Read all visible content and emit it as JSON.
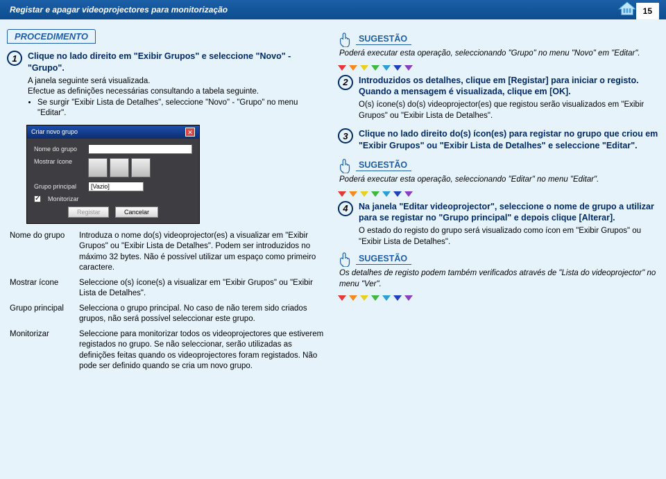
{
  "header": {
    "title": "Registar e apagar videoprojectores para monitorização",
    "page_number": "15",
    "top_icon_label": "TOP"
  },
  "procedimento_label": "PROCEDIMENTO",
  "sugestao_label": "SUGESTÃO",
  "left": {
    "step1": {
      "num": "1",
      "title": "Clique no lado direito em \"Exibir Grupos\" e seleccione \"Novo\" - \"Grupo\".",
      "line1": "A janela seguinte será visualizada.",
      "line2": "Efectue as definições necessárias consultando a tabela seguinte.",
      "bullet": "Se surgir \"Exibir Lista de Detalhes\", seleccione \"Novo\" - \"Grupo\" no menu \"Editar\"."
    },
    "dialog": {
      "title": "Criar novo grupo",
      "label_nome": "Nome do grupo",
      "label_mostrar": "Mostrar ícone",
      "label_grupo": "Grupo principal",
      "value_grupo": "[Vazio]",
      "label_monitorizar": "Monitorizar",
      "btn_registar": "Registar",
      "btn_cancelar": "Cancelar"
    },
    "table": {
      "r1_term": "Nome do grupo",
      "r1_desc": "Introduza o nome do(s) videoprojector(es) a visualizar em \"Exibir Grupos\" ou \"Exibir Lista de Detalhes\". Podem ser introduzidos no máximo 32 bytes. Não é possível utilizar um espaço como primeiro caractere.",
      "r2_term": "Mostrar ícone",
      "r2_desc": "Seleccione o(s) ícone(s) a visualizar em \"Exibir Grupos\" ou \"Exibir Lista de Detalhes\".",
      "r3_term": "Grupo principal",
      "r3_desc": "Selecciona o grupo principal. No caso de não terem sido criados grupos, não será possível seleccionar este grupo.",
      "r4_term": "Monitorizar",
      "r4_desc": "Seleccione para monitorizar todos os videoprojectores que estiverem registados no grupo. Se não seleccionar, serão utilizadas as definições feitas quando os videoprojectores foram registados. Não pode ser definido quando se cria um novo grupo."
    }
  },
  "right": {
    "sug1": "Poderá executar esta operação, seleccionando \"Grupo\" no menu \"Novo\" em \"Editar\".",
    "step2": {
      "num": "2",
      "title": "Introduzidos os detalhes, clique em [Registar] para iniciar o registo. Quando a mensagem é visualizada, clique em [OK].",
      "body": "O(s) ícone(s) do(s) videoprojector(es) que registou serão visualizados em \"Exibir Grupos\" ou \"Exibir Lista de Detalhes\"."
    },
    "step3": {
      "num": "3",
      "title": "Clique no lado direito do(s) ícon(es) para registar no grupo que criou em \"Exibir Grupos\" ou \"Exibir Lista de Detalhes\" e seleccione \"Editar\"."
    },
    "sug2": "Poderá executar esta operação, seleccionando \"Editar\" no menu \"Editar\".",
    "step4": {
      "num": "4",
      "title": "Na janela \"Editar videoprojector\", seleccione o nome de grupo a utilizar para se registar no \"Grupo principal\" e depois clique [Alterar].",
      "body": "O estado do registo do grupo será visualizado como ícon em \"Exibir Grupos\" ou \"Exibir Lista de Detalhes\"."
    },
    "sug3": "Os detalhes de registo podem também verificados através de \"Lista do videoprojector\" no menu \"Ver\"."
  }
}
